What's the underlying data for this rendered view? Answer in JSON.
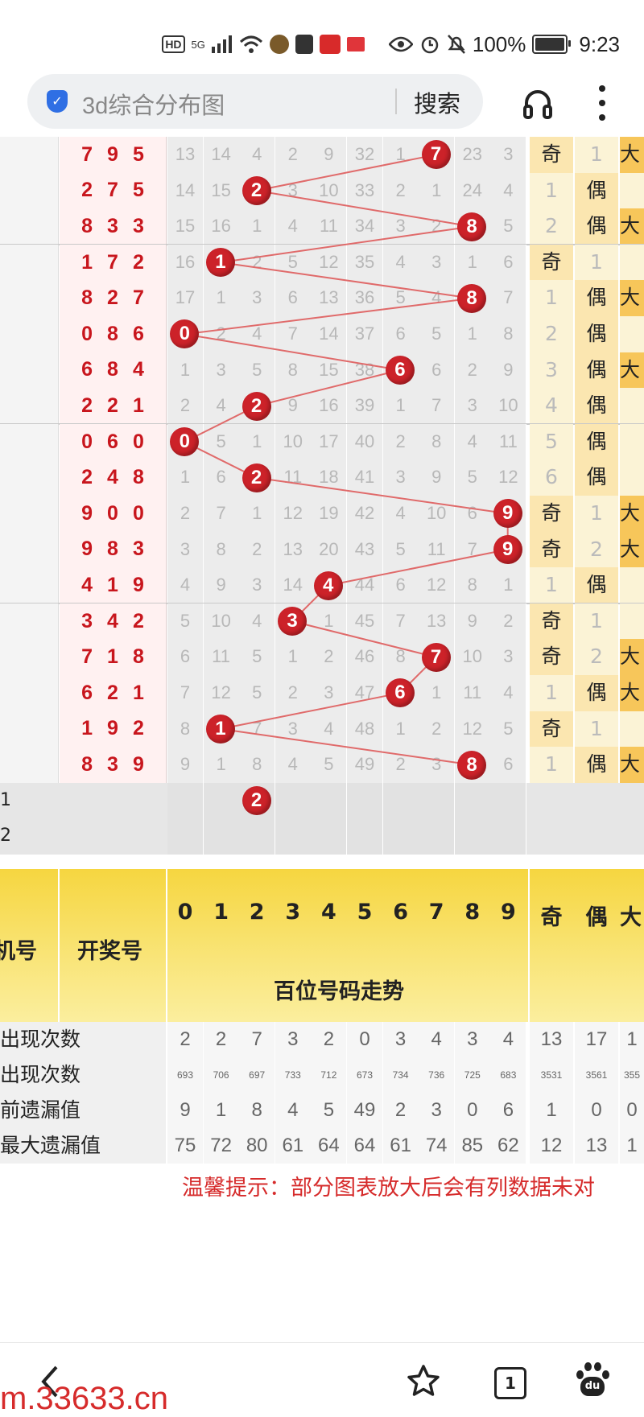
{
  "status_bar": {
    "hd": "HD",
    "network": "5G",
    "battery": "100%",
    "time": "9:23"
  },
  "address_bar": {
    "placeholder": "3d综合分布图",
    "search_label": "搜索"
  },
  "draws": [
    {
      "num": [
        "7",
        "9",
        "5"
      ],
      "miss": [
        "13",
        "14",
        "4",
        "2",
        "9",
        "32",
        "1",
        "7",
        "23",
        "3"
      ],
      "ball": 7,
      "odd": "奇",
      "even": "1",
      "big": "大"
    },
    {
      "num": [
        "2",
        "7",
        "5"
      ],
      "miss": [
        "14",
        "15",
        "2",
        "3",
        "10",
        "33",
        "2",
        "1",
        "24",
        "4"
      ],
      "ball": 2,
      "odd": "1",
      "even": "偶",
      "big": ""
    },
    {
      "num": [
        "8",
        "3",
        "3"
      ],
      "miss": [
        "15",
        "16",
        "1",
        "4",
        "11",
        "34",
        "3",
        "2",
        "8",
        "5"
      ],
      "ball": 8,
      "odd": "2",
      "even": "偶",
      "big": "大"
    },
    {
      "num": [
        "1",
        "7",
        "2"
      ],
      "miss": [
        "16",
        "1",
        "2",
        "5",
        "12",
        "35",
        "4",
        "3",
        "1",
        "6"
      ],
      "ball": 1,
      "odd": "奇",
      "even": "1",
      "big": ""
    },
    {
      "num": [
        "8",
        "2",
        "7"
      ],
      "miss": [
        "17",
        "1",
        "3",
        "6",
        "13",
        "36",
        "5",
        "4",
        "8",
        "7"
      ],
      "ball": 8,
      "odd": "1",
      "even": "偶",
      "big": "大"
    },
    {
      "num": [
        "0",
        "8",
        "6"
      ],
      "miss": [
        "0",
        "2",
        "4",
        "7",
        "14",
        "37",
        "6",
        "5",
        "1",
        "8"
      ],
      "ball": 0,
      "odd": "2",
      "even": "偶",
      "big": ""
    },
    {
      "num": [
        "6",
        "8",
        "4"
      ],
      "miss": [
        "1",
        "3",
        "5",
        "8",
        "15",
        "38",
        "6",
        "6",
        "2",
        "9"
      ],
      "ball": 6,
      "odd": "3",
      "even": "偶",
      "big": "大"
    },
    {
      "num": [
        "2",
        "2",
        "1"
      ],
      "miss": [
        "2",
        "4",
        "2",
        "9",
        "16",
        "39",
        "1",
        "7",
        "3",
        "10"
      ],
      "ball": 2,
      "odd": "4",
      "even": "偶",
      "big": ""
    },
    {
      "num": [
        "0",
        "6",
        "0"
      ],
      "miss": [
        "0",
        "5",
        "1",
        "10",
        "17",
        "40",
        "2",
        "8",
        "4",
        "11"
      ],
      "ball": 0,
      "odd": "5",
      "even": "偶",
      "big": ""
    },
    {
      "num": [
        "2",
        "4",
        "8"
      ],
      "miss": [
        "1",
        "6",
        "2",
        "11",
        "18",
        "41",
        "3",
        "9",
        "5",
        "12"
      ],
      "ball": 2,
      "odd": "6",
      "even": "偶",
      "big": ""
    },
    {
      "num": [
        "9",
        "0",
        "0"
      ],
      "miss": [
        "2",
        "7",
        "1",
        "12",
        "19",
        "42",
        "4",
        "10",
        "6",
        "9"
      ],
      "ball": 9,
      "odd": "奇",
      "even": "1",
      "big": "大"
    },
    {
      "num": [
        "9",
        "8",
        "3"
      ],
      "miss": [
        "3",
        "8",
        "2",
        "13",
        "20",
        "43",
        "5",
        "11",
        "7",
        "9"
      ],
      "ball": 9,
      "odd": "奇",
      "even": "2",
      "big": "大"
    },
    {
      "num": [
        "4",
        "1",
        "9"
      ],
      "miss": [
        "4",
        "9",
        "3",
        "14",
        "4",
        "44",
        "6",
        "12",
        "8",
        "1"
      ],
      "ball": 4,
      "odd": "1",
      "even": "偶",
      "big": ""
    },
    {
      "num": [
        "3",
        "4",
        "2"
      ],
      "miss": [
        "5",
        "10",
        "4",
        "3",
        "1",
        "45",
        "7",
        "13",
        "9",
        "2"
      ],
      "ball": 3,
      "odd": "奇",
      "even": "1",
      "big": ""
    },
    {
      "num": [
        "7",
        "1",
        "8"
      ],
      "miss": [
        "6",
        "11",
        "5",
        "1",
        "2",
        "46",
        "8",
        "7",
        "10",
        "3"
      ],
      "ball": 7,
      "odd": "奇",
      "even": "2",
      "big": "大"
    },
    {
      "num": [
        "6",
        "2",
        "1"
      ],
      "miss": [
        "7",
        "12",
        "5",
        "2",
        "3",
        "47",
        "6",
        "1",
        "11",
        "4"
      ],
      "ball": 6,
      "odd": "1",
      "even": "偶",
      "big": "大"
    },
    {
      "num": [
        "1",
        "9",
        "2"
      ],
      "miss": [
        "8",
        "1",
        "7",
        "3",
        "4",
        "48",
        "1",
        "2",
        "12",
        "5"
      ],
      "ball": 1,
      "odd": "奇",
      "even": "1",
      "big": ""
    },
    {
      "num": [
        "8",
        "3",
        "9"
      ],
      "miss": [
        "9",
        "1",
        "8",
        "4",
        "5",
        "49",
        "2",
        "3",
        "8",
        "6"
      ],
      "ball": 8,
      "odd": "1",
      "even": "偶",
      "big": "大"
    }
  ],
  "forecast_rows": [
    {
      "label": "1",
      "ball": 2
    },
    {
      "label": "2",
      "ball": null
    }
  ],
  "header": {
    "digits": [
      "0",
      "1",
      "2",
      "3",
      "4",
      "5",
      "6",
      "7",
      "8",
      "9"
    ],
    "odd": "奇",
    "even": "偶",
    "big": "大",
    "col_issue": "机号",
    "col_number": "开奖号",
    "section_title": "百位号码走势"
  },
  "stats": [
    {
      "label": "出现次数",
      "values": [
        "2",
        "2",
        "7",
        "3",
        "2",
        "0",
        "3",
        "4",
        "3",
        "4"
      ],
      "odd": "13",
      "even": "17",
      "big": "1",
      "small": false
    },
    {
      "label": "出现次数",
      "values": [
        "693",
        "706",
        "697",
        "733",
        "712",
        "673",
        "734",
        "736",
        "725",
        "683"
      ],
      "odd": "3531",
      "even": "3561",
      "big": "355",
      "small": true
    },
    {
      "label": "前遗漏值",
      "values": [
        "9",
        "1",
        "8",
        "4",
        "5",
        "49",
        "2",
        "3",
        "0",
        "6"
      ],
      "odd": "1",
      "even": "0",
      "big": "0",
      "small": false
    },
    {
      "label": "最大遗漏值",
      "values": [
        "75",
        "72",
        "80",
        "61",
        "64",
        "64",
        "61",
        "74",
        "85",
        "62"
      ],
      "odd": "12",
      "even": "13",
      "big": "1",
      "small": false
    }
  ],
  "tip": "温馨提示：部分图表放大后会有列数据未对",
  "bottom_nav": {
    "tab_count": "1",
    "baidu": "du"
  },
  "watermark": "m.33633.cn",
  "colors": {
    "accent_red": "#cc2229",
    "header_yellow": "#f6d640",
    "link_blue": "#2f6fe4"
  }
}
